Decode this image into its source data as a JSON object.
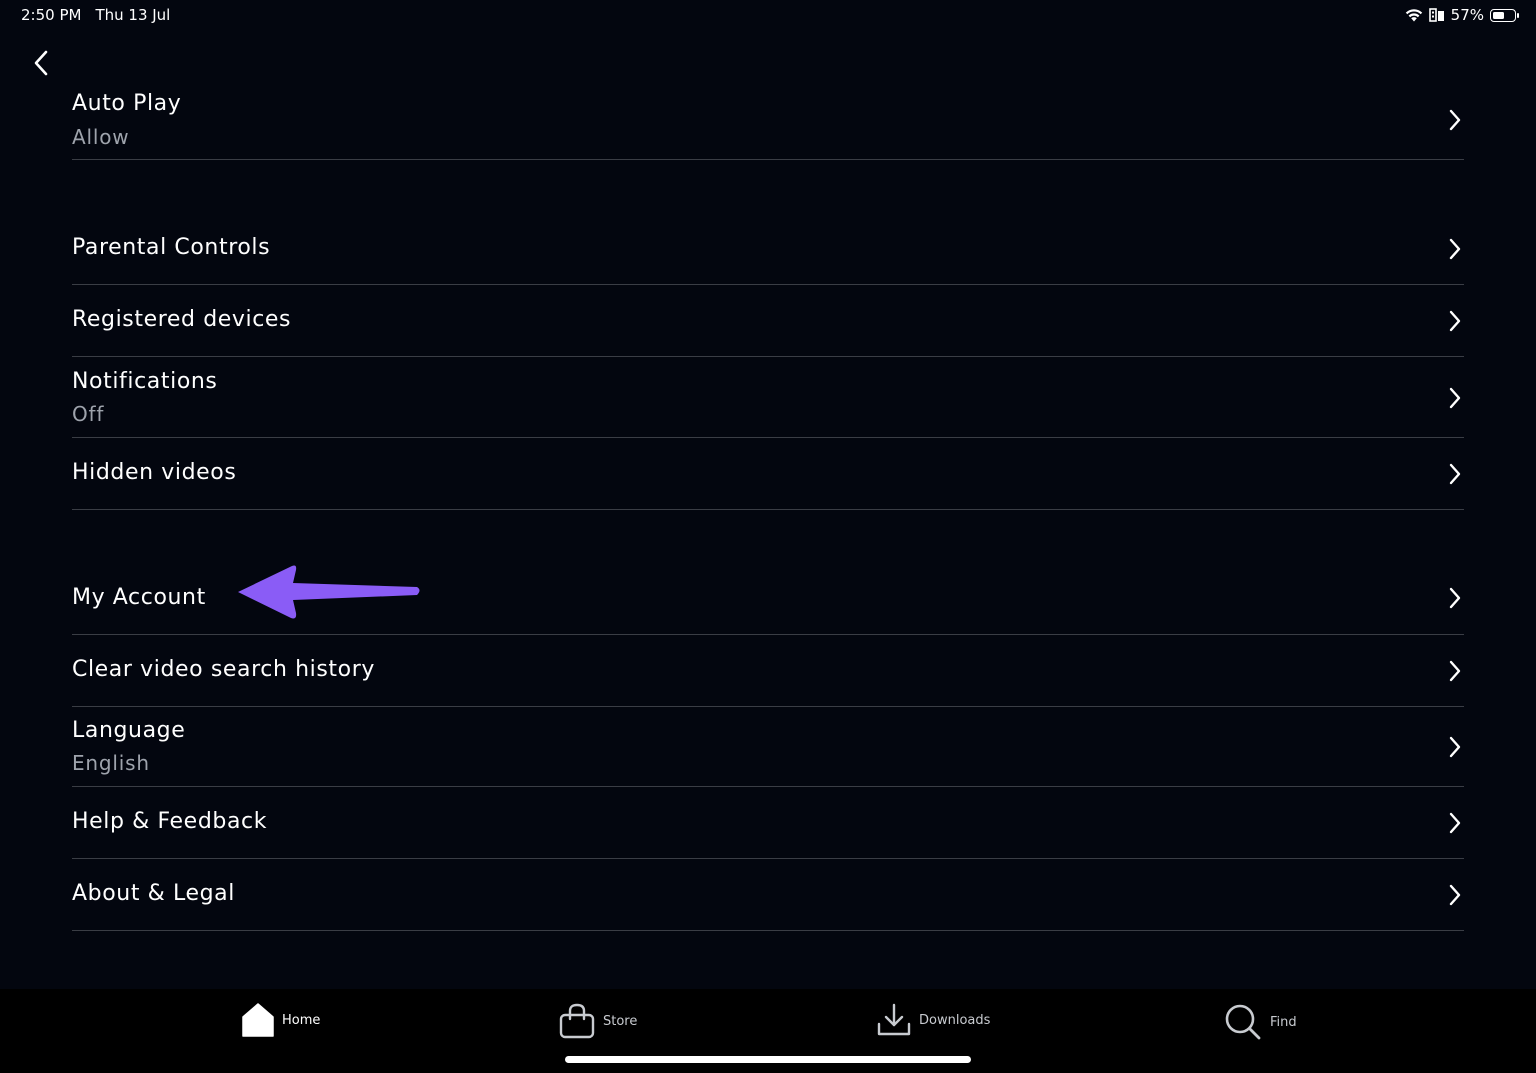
{
  "status_bar": {
    "time": "2:50 PM",
    "date": "Thu 13 Jul",
    "battery_text": "57%",
    "battery_level": 0.57
  },
  "header": {
    "back_icon": "chevron-left-icon"
  },
  "settings": {
    "auto_play": {
      "title": "Auto Play",
      "value": "Allow"
    },
    "parental_controls": {
      "title": "Parental Controls"
    },
    "registered_devices": {
      "title": "Registered devices"
    },
    "notifications": {
      "title": "Notifications",
      "value": "Off"
    },
    "hidden_videos": {
      "title": "Hidden videos"
    },
    "my_account": {
      "title": "My Account"
    },
    "clear_search_history": {
      "title": "Clear video search history"
    },
    "language": {
      "title": "Language",
      "value": "English"
    },
    "help_feedback": {
      "title": "Help & Feedback"
    },
    "about_legal": {
      "title": "About & Legal"
    }
  },
  "annotation": {
    "arrow_color": "#8a5cf6",
    "points_to": "My Account"
  },
  "bottom_nav": {
    "items": [
      {
        "label": "Home",
        "icon": "home-icon",
        "active": true
      },
      {
        "label": "Store",
        "icon": "shopping-bag-icon",
        "active": false
      },
      {
        "label": "Downloads",
        "icon": "download-icon",
        "active": false
      },
      {
        "label": "Find",
        "icon": "search-icon",
        "active": false
      }
    ]
  },
  "colors": {
    "background": "#03060f",
    "divider": "#3a3d45",
    "subtitle": "#9ea3ac",
    "nav_background": "#000000"
  }
}
